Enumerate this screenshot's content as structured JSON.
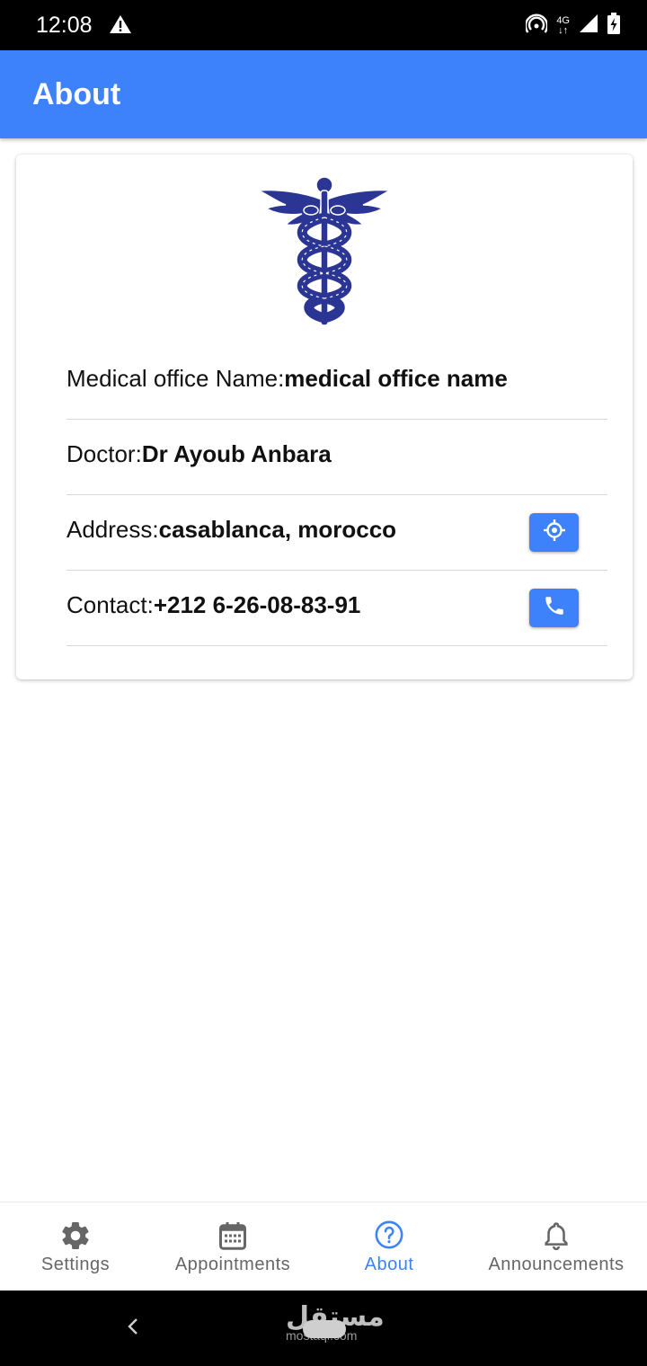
{
  "status_bar": {
    "time": "12:08",
    "network": "4G",
    "icons": [
      "alert-icon",
      "hotspot-icon",
      "signal-icon",
      "battery-charging-icon"
    ]
  },
  "app_bar": {
    "title": "About"
  },
  "about": {
    "logo": "caduceus-icon",
    "rows": [
      {
        "label": "Medical office Name:",
        "value": "medical office name"
      },
      {
        "label": "Doctor:",
        "value": "Dr Ayoub Anbara"
      },
      {
        "label": "Address:",
        "value": "casablanca, morocco",
        "action_icon": "locate-icon"
      },
      {
        "label": "Contact:",
        "value": "+212 6-26-08-83-91",
        "action_icon": "phone-icon"
      }
    ]
  },
  "bottom_nav": {
    "items": [
      {
        "label": "Settings",
        "icon": "gear-icon",
        "active": false
      },
      {
        "label": "Appointments",
        "icon": "calendar-icon",
        "active": false
      },
      {
        "label": "About",
        "icon": "help-circle-icon",
        "active": true
      },
      {
        "label": "Announcements",
        "icon": "bell-icon",
        "active": false
      }
    ]
  },
  "watermark": {
    "text": "مستقل",
    "subtext": "mostaql.com"
  },
  "colors": {
    "primary": "#3d82fb",
    "logo": "#2b3594",
    "inactive": "#666666"
  }
}
